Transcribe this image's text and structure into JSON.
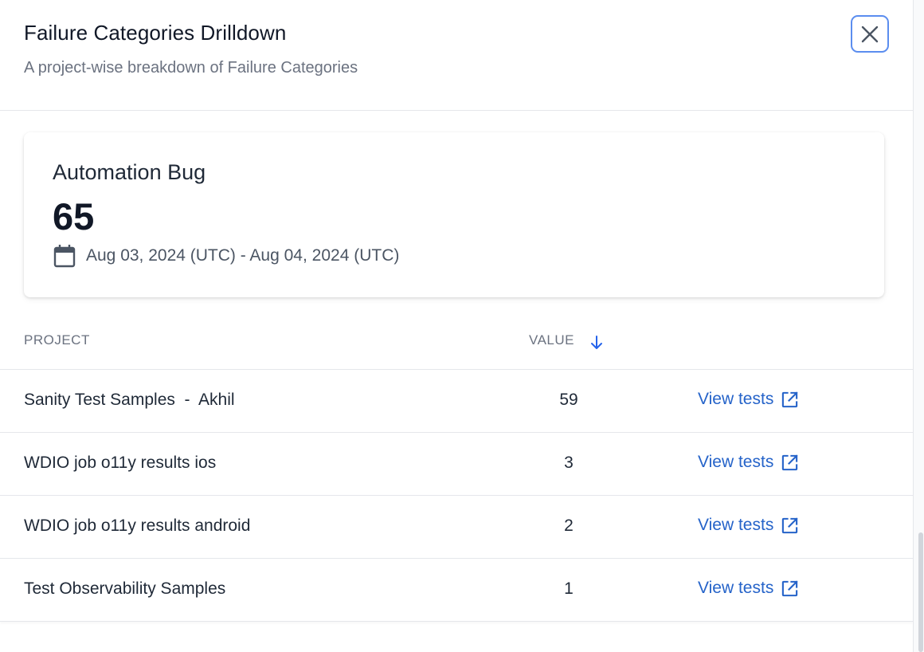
{
  "header": {
    "title": "Failure Categories Drilldown",
    "subtitle": "A project-wise breakdown of Failure Categories"
  },
  "summary": {
    "category": "Automation Bug",
    "total": "65",
    "date_range": "Aug 03, 2024 (UTC) - Aug 04, 2024 (UTC)"
  },
  "table": {
    "columns": {
      "project": "PROJECT",
      "value": "VALUE"
    },
    "sort": "descending",
    "rows": [
      {
        "project": "Sanity Test Samples  -  Akhil",
        "value": "59",
        "action": "View tests"
      },
      {
        "project": "WDIO job o11y results ios",
        "value": "3",
        "action": "View tests"
      },
      {
        "project": "WDIO job o11y results android",
        "value": "2",
        "action": "View tests"
      },
      {
        "project": "Test Observability Samples",
        "value": "1",
        "action": "View tests"
      }
    ]
  },
  "icons": {
    "close": "close-icon",
    "calendar": "calendar-icon",
    "sort": "arrow-down-icon",
    "external": "external-link-icon"
  },
  "colors": {
    "link": "#2563c9",
    "close_border": "#5b8def",
    "sort_arrow": "#2563eb"
  }
}
